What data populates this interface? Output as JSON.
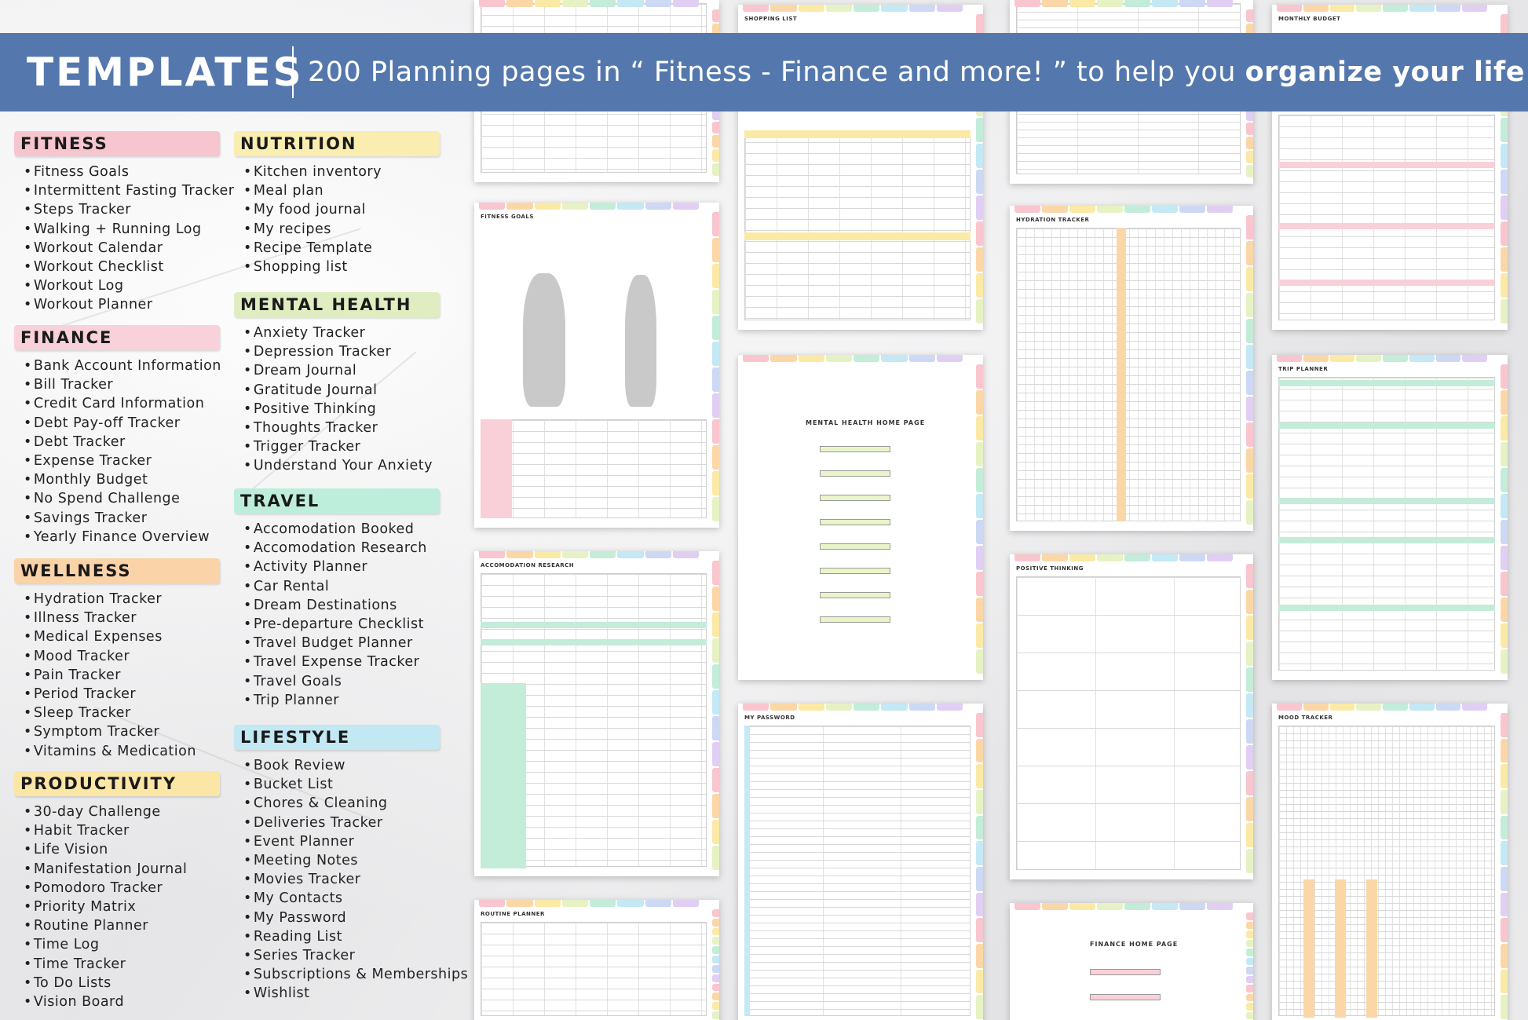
{
  "banner": {
    "title": "TEMPLATES",
    "subtitle_prefix": "200 Planning pages in “ Fitness - Finance and more! ” to help you",
    "subtitle_emphasis": "organize your life"
  },
  "colors": {
    "banner": "#5478ad",
    "fitness": "#f7c5cf",
    "finance": "#f8d1da",
    "wellness": "#fbd3a8",
    "productivity": "#fbe6a6",
    "nutrition": "#faedb0",
    "mental_health": "#dfedc1",
    "travel": "#bdeedb",
    "lifestyle": "#c2e8f3"
  },
  "categories": {
    "fitness": {
      "title": "FITNESS",
      "items": [
        "Fitness Goals",
        "Intermittent Fasting Tracker",
        "Steps Tracker",
        "Walking + Running Log",
        "Workout Calendar",
        "Workout Checklist",
        "Workout Log",
        "Workout Planner"
      ]
    },
    "finance": {
      "title": "FINANCE",
      "items": [
        "Bank Account Information",
        "Bill Tracker",
        "Credit Card Information",
        "Debt Pay-off Tracker",
        "Debt Tracker",
        "Expense Tracker",
        "Monthly Budget",
        "No Spend Challenge",
        "Savings Tracker",
        "Yearly Finance Overview"
      ]
    },
    "wellness": {
      "title": "WELLNESS",
      "items": [
        "Hydration Tracker",
        "Illness Tracker",
        "Medical Expenses",
        "Mood Tracker",
        "Pain Tracker",
        "Period Tracker",
        "Sleep Tracker",
        "Symptom Tracker",
        "Vitamins & Medication"
      ]
    },
    "productivity": {
      "title": "PRODUCTIVITY",
      "items": [
        "30-day Challenge",
        "Habit Tracker",
        "Life Vision",
        "Manifestation Journal",
        "Pomodoro Tracker",
        "Priority Matrix",
        "Routine Planner",
        "Time Log",
        "Time Tracker",
        "To Do Lists",
        "Vision Board"
      ]
    },
    "nutrition": {
      "title": "NUTRITION",
      "items": [
        "Kitchen inventory",
        "Meal plan",
        "My food journal",
        "My recipes",
        "Recipe Template",
        "Shopping list"
      ]
    },
    "mental_health": {
      "title": "MENTAL HEALTH",
      "items": [
        "Anxiety Tracker",
        "Depression Tracker",
        "Dream Journal",
        "Gratitude Journal",
        "Positive Thinking",
        "Thoughts Tracker",
        "Trigger Tracker",
        "Understand Your Anxiety"
      ]
    },
    "travel": {
      "title": "TRAVEL",
      "items": [
        "Accomodation Booked",
        "Accomodation Research",
        "Activity Planner",
        "Car Rental",
        "Dream Destinations",
        "Pre-departure Checklist",
        "Travel Budget Planner",
        "Travel Expense Tracker",
        "Travel Goals",
        "Trip Planner"
      ]
    },
    "lifestyle": {
      "title": "LIFESTYLE",
      "items": [
        "Book Review",
        "Bucket List",
        "Chores & Cleaning",
        "Deliveries Tracker",
        "Event Planner",
        "Meeting Notes",
        "Movies Tracker",
        "My Contacts",
        "My Password",
        "Reading List",
        "Series Tracker",
        "Subscriptions & Memberships",
        "Wishlist"
      ]
    }
  },
  "previews": {
    "shopping_list": "SHOPPING LIST",
    "monthly_budget": "MONTHLY BUDGET",
    "fitness_goals": "FITNESS GOALS",
    "hydration_tracker": "HYDRATION TRACKER",
    "mental_health_home": "MENTAL HEALTH HOME PAGE",
    "trip_planner": "TRIP PLANNER",
    "accomodation_research": "ACCOMODATION RESEARCH",
    "positive_thinking": "POSITIVE THINKING",
    "my_password": "MY PASSWORD",
    "mood_tracker": "MOOD TRACKER",
    "routine_planner": "ROUTINE PLANNER",
    "finance_home": "FINANCE HOME PAGE"
  },
  "tab_colors": [
    "#f9c6cf",
    "#fbd7a8",
    "#fbe9a6",
    "#e6f2c4",
    "#c3ecd9",
    "#c4e8f4",
    "#cdd8f4",
    "#e0cff3"
  ]
}
